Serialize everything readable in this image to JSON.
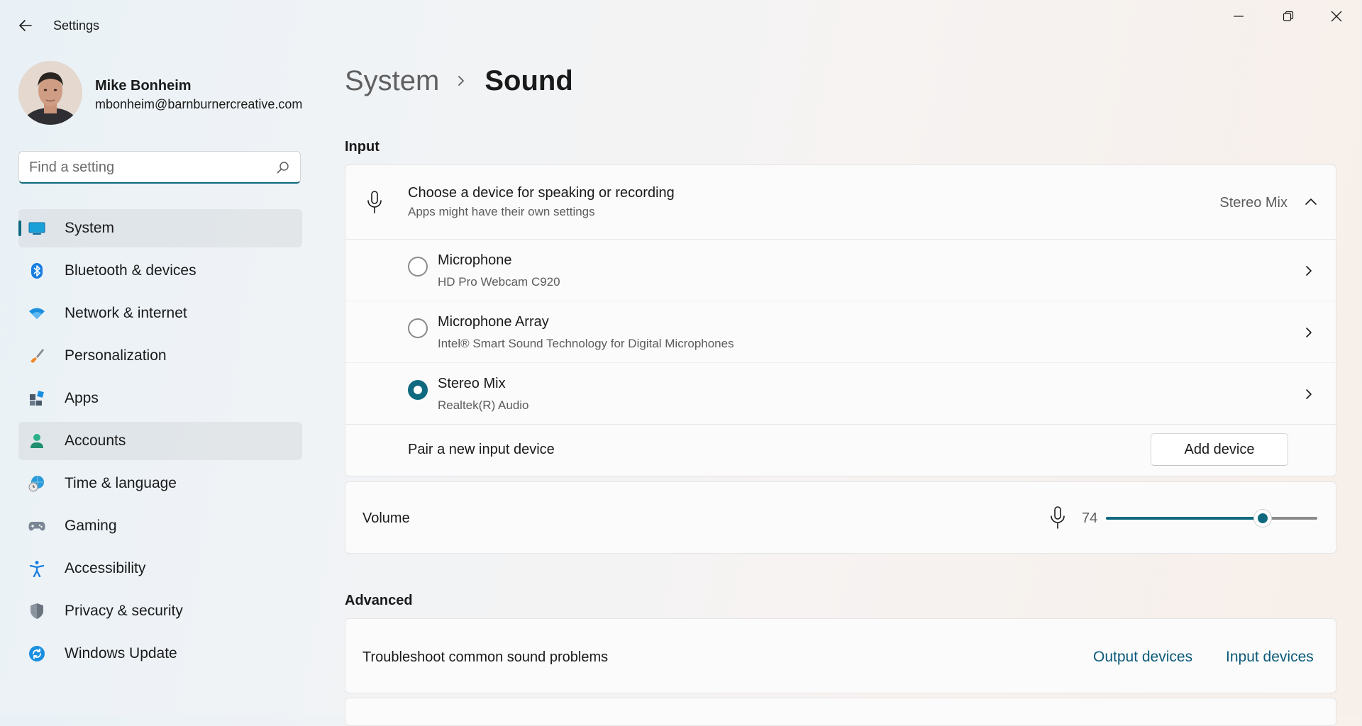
{
  "window": {
    "title": "Settings",
    "controls": [
      "minimize-icon",
      "restore-icon",
      "close-icon"
    ]
  },
  "profile": {
    "name": "Mike Bonheim",
    "email": "mbonheim@barnburnercreative.com"
  },
  "search": {
    "placeholder": "Find a setting",
    "value": ""
  },
  "nav": {
    "selected_index": 0,
    "hover_index": 5,
    "items": [
      {
        "label": "System",
        "icon": "system-display-icon"
      },
      {
        "label": "Bluetooth & devices",
        "icon": "bluetooth-icon"
      },
      {
        "label": "Network & internet",
        "icon": "wifi-icon"
      },
      {
        "label": "Personalization",
        "icon": "brush-icon"
      },
      {
        "label": "Apps",
        "icon": "apps-icon"
      },
      {
        "label": "Accounts",
        "icon": "person-icon"
      },
      {
        "label": "Time & language",
        "icon": "globe-clock-icon"
      },
      {
        "label": "Gaming",
        "icon": "gamepad-icon"
      },
      {
        "label": "Accessibility",
        "icon": "accessibility-icon"
      },
      {
        "label": "Privacy & security",
        "icon": "shield-icon"
      },
      {
        "label": "Windows Update",
        "icon": "update-icon"
      }
    ]
  },
  "breadcrumb": {
    "parent": "System",
    "current": "Sound"
  },
  "input_section": {
    "title": "Input",
    "chooser": {
      "title": "Choose a device for speaking or recording",
      "subtitle": "Apps might have their own settings",
      "selected_value": "Stereo Mix",
      "expanded": true
    },
    "devices": [
      {
        "name": "Microphone",
        "description": "HD Pro Webcam C920",
        "selected": false
      },
      {
        "name": "Microphone Array",
        "description": "Intel® Smart Sound Technology for Digital Microphones",
        "selected": false
      },
      {
        "name": "Stereo Mix",
        "description": "Realtek(R) Audio",
        "selected": true
      }
    ],
    "pair": {
      "label": "Pair a new input device",
      "button_label": "Add device"
    },
    "volume": {
      "label": "Volume",
      "value": "74",
      "level": 74
    }
  },
  "advanced_section": {
    "title": "Advanced",
    "troubleshoot": {
      "label": "Troubleshoot common sound problems",
      "output_link": "Output devices",
      "input_link": "Input devices"
    }
  },
  "colors": {
    "accent": "#0f6a80",
    "link": "#0b5a7a"
  }
}
